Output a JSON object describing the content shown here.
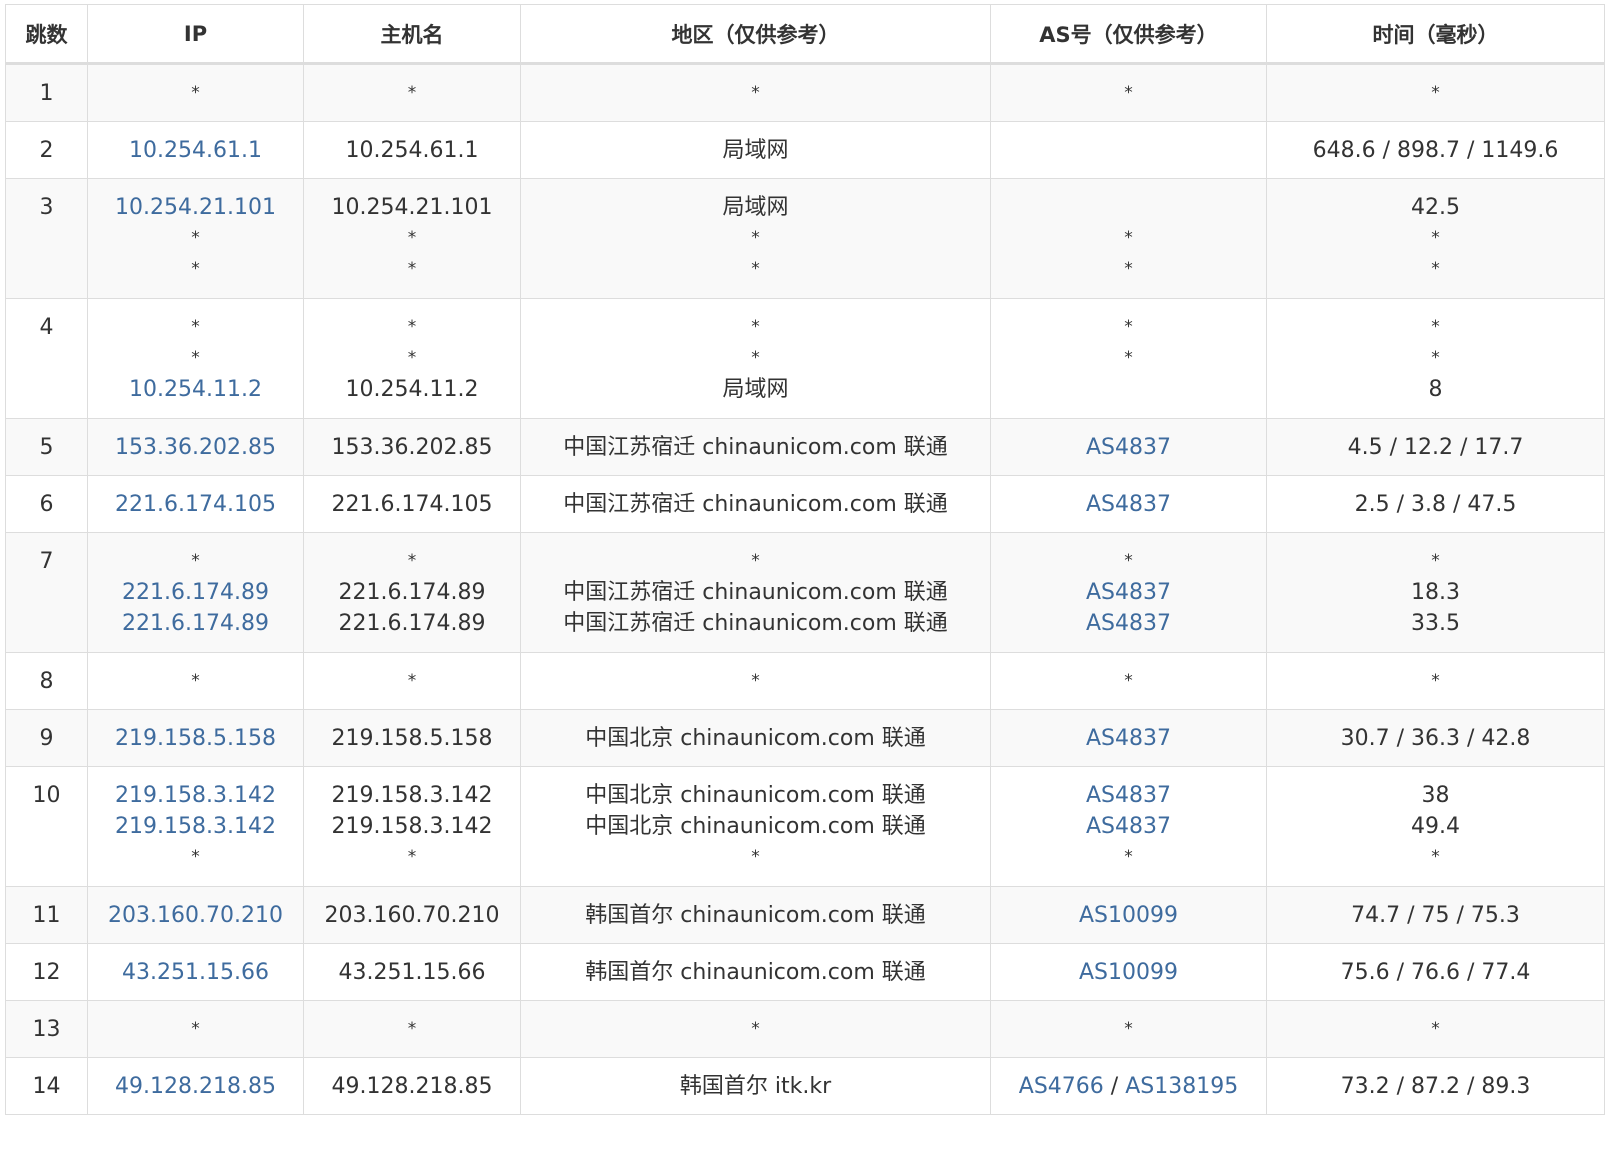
{
  "table": {
    "headers": [
      "跳数",
      "IP",
      "主机名",
      "地区（仅供参考）",
      "AS号（仅供参考）",
      "时间（毫秒）"
    ],
    "rows": [
      {
        "hop": "1",
        "lines": [
          {
            "ip": "*",
            "host": "*",
            "region": "*",
            "as": [
              "*"
            ],
            "time": "*"
          }
        ]
      },
      {
        "hop": "2",
        "lines": [
          {
            "ip": "10.254.61.1",
            "host": "10.254.61.1",
            "region": "局域网",
            "as": [],
            "time": "648.6 / 898.7 / 1149.6"
          }
        ]
      },
      {
        "hop": "3",
        "lines": [
          {
            "ip": "10.254.21.101",
            "host": "10.254.21.101",
            "region": "局域网",
            "as": [],
            "time": "42.5"
          },
          {
            "ip": "*",
            "host": "*",
            "region": "*",
            "as": [
              "*"
            ],
            "time": "*"
          },
          {
            "ip": "*",
            "host": "*",
            "region": "*",
            "as": [
              "*"
            ],
            "time": "*"
          }
        ]
      },
      {
        "hop": "4",
        "lines": [
          {
            "ip": "*",
            "host": "*",
            "region": "*",
            "as": [
              "*"
            ],
            "time": "*"
          },
          {
            "ip": "*",
            "host": "*",
            "region": "*",
            "as": [
              "*"
            ],
            "time": "*"
          },
          {
            "ip": "10.254.11.2",
            "host": "10.254.11.2",
            "region": "局域网",
            "as": [],
            "time": "8"
          }
        ]
      },
      {
        "hop": "5",
        "lines": [
          {
            "ip": "153.36.202.85",
            "host": "153.36.202.85",
            "region": "中国江苏宿迁 chinaunicom.com 联通",
            "as": [
              "AS4837"
            ],
            "time": "4.5 / 12.2 / 17.7"
          }
        ]
      },
      {
        "hop": "6",
        "lines": [
          {
            "ip": "221.6.174.105",
            "host": "221.6.174.105",
            "region": "中国江苏宿迁 chinaunicom.com 联通",
            "as": [
              "AS4837"
            ],
            "time": "2.5 / 3.8 / 47.5"
          }
        ]
      },
      {
        "hop": "7",
        "lines": [
          {
            "ip": "*",
            "host": "*",
            "region": "*",
            "as": [
              "*"
            ],
            "time": "*"
          },
          {
            "ip": "221.6.174.89",
            "host": "221.6.174.89",
            "region": "中国江苏宿迁 chinaunicom.com 联通",
            "as": [
              "AS4837"
            ],
            "time": "18.3"
          },
          {
            "ip": "221.6.174.89",
            "host": "221.6.174.89",
            "region": "中国江苏宿迁 chinaunicom.com 联通",
            "as": [
              "AS4837"
            ],
            "time": "33.5"
          }
        ]
      },
      {
        "hop": "8",
        "lines": [
          {
            "ip": "*",
            "host": "*",
            "region": "*",
            "as": [
              "*"
            ],
            "time": "*"
          }
        ]
      },
      {
        "hop": "9",
        "lines": [
          {
            "ip": "219.158.5.158",
            "host": "219.158.5.158",
            "region": "中国北京 chinaunicom.com 联通",
            "as": [
              "AS4837"
            ],
            "time": "30.7 / 36.3 / 42.8"
          }
        ]
      },
      {
        "hop": "10",
        "lines": [
          {
            "ip": "219.158.3.142",
            "host": "219.158.3.142",
            "region": "中国北京 chinaunicom.com 联通",
            "as": [
              "AS4837"
            ],
            "time": "38"
          },
          {
            "ip": "219.158.3.142",
            "host": "219.158.3.142",
            "region": "中国北京 chinaunicom.com 联通",
            "as": [
              "AS4837"
            ],
            "time": "49.4"
          },
          {
            "ip": "*",
            "host": "*",
            "region": "*",
            "as": [
              "*"
            ],
            "time": "*"
          }
        ]
      },
      {
        "hop": "11",
        "lines": [
          {
            "ip": "203.160.70.210",
            "host": "203.160.70.210",
            "region": "韩国首尔 chinaunicom.com 联通",
            "as": [
              "AS10099"
            ],
            "time": "74.7 / 75 / 75.3"
          }
        ]
      },
      {
        "hop": "12",
        "lines": [
          {
            "ip": "43.251.15.66",
            "host": "43.251.15.66",
            "region": "韩国首尔 chinaunicom.com 联通",
            "as": [
              "AS10099"
            ],
            "time": "75.6 / 76.6 / 77.4"
          }
        ]
      },
      {
        "hop": "13",
        "lines": [
          {
            "ip": "*",
            "host": "*",
            "region": "*",
            "as": [
              "*"
            ],
            "time": "*"
          }
        ]
      },
      {
        "hop": "14",
        "lines": [
          {
            "ip": "49.128.218.85",
            "host": "49.128.218.85",
            "region": "韩国首尔 itk.kr",
            "as": [
              "AS4766",
              "AS138195"
            ],
            "time": "73.2 / 87.2 / 89.3"
          }
        ]
      }
    ]
  },
  "colors": {
    "link": "#3e6b9e",
    "text": "#333333",
    "border": "#dddddd",
    "stripe": "#f9f9f9"
  }
}
